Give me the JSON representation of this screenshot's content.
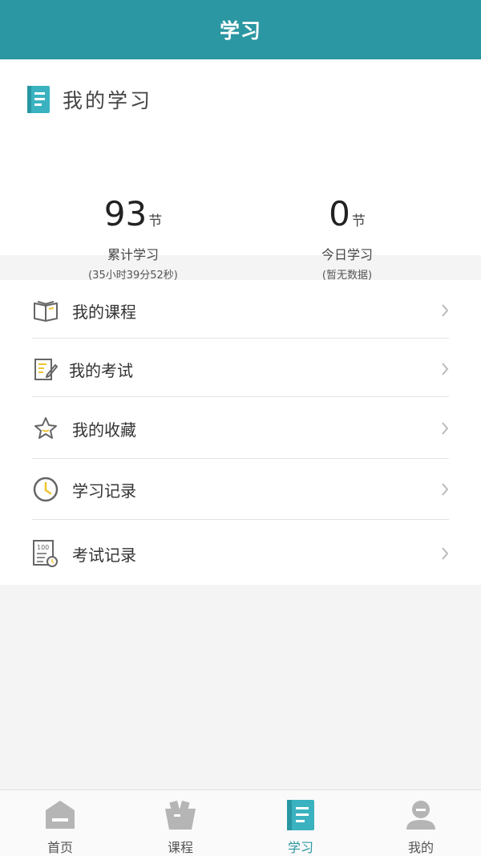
{
  "header": {
    "title": "学习"
  },
  "summary": {
    "title": "我的学习",
    "total": {
      "value": "93",
      "unit": "节",
      "label": "累计学习",
      "detail": "(35小时39分52秒)"
    },
    "today": {
      "value": "0",
      "unit": "节",
      "label": "今日学习",
      "detail": "(暂无数据)"
    }
  },
  "menu": {
    "items": [
      {
        "label": "我的课程",
        "icon": "open-book-icon"
      },
      {
        "label": "我的考试",
        "icon": "exam-edit-icon"
      },
      {
        "label": "我的收藏",
        "icon": "star-icon"
      },
      {
        "label": "学习记录",
        "icon": "clock-icon"
      },
      {
        "label": "考试记录",
        "icon": "score-sheet-icon"
      }
    ]
  },
  "tabbar": {
    "tabs": [
      {
        "label": "首页",
        "icon": "home-icon"
      },
      {
        "label": "课程",
        "icon": "basket-icon"
      },
      {
        "label": "学习",
        "icon": "notebook-icon",
        "active": true
      },
      {
        "label": "我的",
        "icon": "user-icon"
      }
    ]
  },
  "colors": {
    "brand": "#2b97a2",
    "icon_accent": "#f0c330",
    "icon_gray": "#666666"
  }
}
